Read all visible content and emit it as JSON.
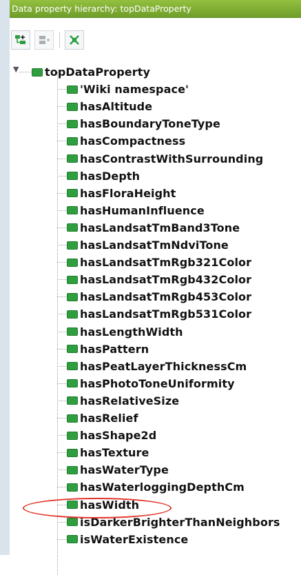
{
  "panel": {
    "title": "Data property hierarchy: topDataProperty"
  },
  "toolbar": {
    "buttons": [
      {
        "name": "add-subproperty-icon",
        "color": "#2e9e3f"
      },
      {
        "name": "add-sibling-property-icon",
        "color": "#9aa3ab"
      },
      {
        "name": "delete-property-icon",
        "color": "#2e9e3f"
      }
    ]
  },
  "tree": {
    "root": "topDataProperty",
    "children": [
      "'Wiki namespace'",
      "hasAltitude",
      "hasBoundaryToneType",
      "hasCompactness",
      "hasContrastWithSurrounding",
      "hasDepth",
      "hasFloraHeight",
      "hasHumanInfluence",
      "hasLandsatTmBand3Tone",
      "hasLandsatTmNdviTone",
      "hasLandsatTmRgb321Color",
      "hasLandsatTmRgb432Color",
      "hasLandsatTmRgb453Color",
      "hasLandsatTmRgb531Color",
      "hasLengthWidth",
      "hasPattern",
      "hasPeatLayerThicknessCm",
      "hasPhotoToneUniformity",
      "hasRelativeSize",
      "hasRelief",
      "hasShape2d",
      "hasTexture",
      "hasWaterType",
      "hasWaterloggingDepthCm",
      "hasWidth",
      "isDarkerBrighterThanNeighbors",
      "isWaterExistence"
    ]
  },
  "colors": {
    "title_bar": "#7fae33",
    "property_icon": "#2e9e3f",
    "annotation_circle": "#e0352b"
  }
}
